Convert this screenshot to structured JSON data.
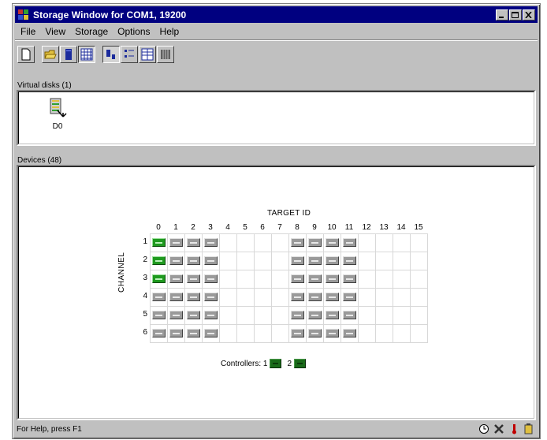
{
  "window": {
    "title": "Storage Window for COM1, 19200"
  },
  "menu": [
    {
      "key": "file",
      "label": "File"
    },
    {
      "key": "view",
      "label": "View"
    },
    {
      "key": "storage",
      "label": "Storage"
    },
    {
      "key": "options",
      "label": "Options"
    },
    {
      "key": "help",
      "label": "Help"
    }
  ],
  "toolbar": {
    "buttons": [
      {
        "icon": "new-document-icon",
        "pressed": false
      },
      {
        "icon": "open-folder-icon",
        "pressed": false
      },
      {
        "icon": "storage-device-icon",
        "pressed": false
      },
      {
        "icon": "grid-view-icon",
        "pressed": true
      },
      {
        "icon": "large-icons-view-icon",
        "pressed": true
      },
      {
        "icon": "small-icons-view-icon",
        "pressed": false
      },
      {
        "icon": "list-view-icon",
        "pressed": false
      },
      {
        "icon": "details-view-icon",
        "pressed": false
      }
    ]
  },
  "virtual_disks": {
    "header": "Virtual disks (1)",
    "items": [
      {
        "label": "D0",
        "icon": "virtual-disk-icon"
      }
    ]
  },
  "devices": {
    "header": "Devices (48)",
    "target_id_label": "TARGET ID",
    "channel_label": "CHANNEL",
    "target_ids": [
      "0",
      "1",
      "2",
      "3",
      "4",
      "5",
      "6",
      "7",
      "8",
      "9",
      "10",
      "11",
      "12",
      "13",
      "14",
      "15"
    ],
    "channels": [
      "1",
      "2",
      "3",
      "4",
      "5",
      "6"
    ],
    "occupied_targets": [
      0,
      1,
      2,
      3,
      8,
      9,
      10,
      11
    ],
    "active_devices": [
      {
        "channel": 1,
        "target": 0
      },
      {
        "channel": 2,
        "target": 0
      },
      {
        "channel": 3,
        "target": 0
      }
    ],
    "controllers_label": "Controllers: 1",
    "controller_2_label": "2",
    "colors": {
      "active": "#1f9a1f",
      "idle": "#9a9a9a",
      "controller": "#1a6a1a"
    }
  },
  "statusbar": {
    "help_text": "For Help, press F1",
    "icons": [
      "status-clock-icon",
      "status-tools-icon",
      "status-thermometer-icon",
      "status-battery-icon"
    ]
  }
}
